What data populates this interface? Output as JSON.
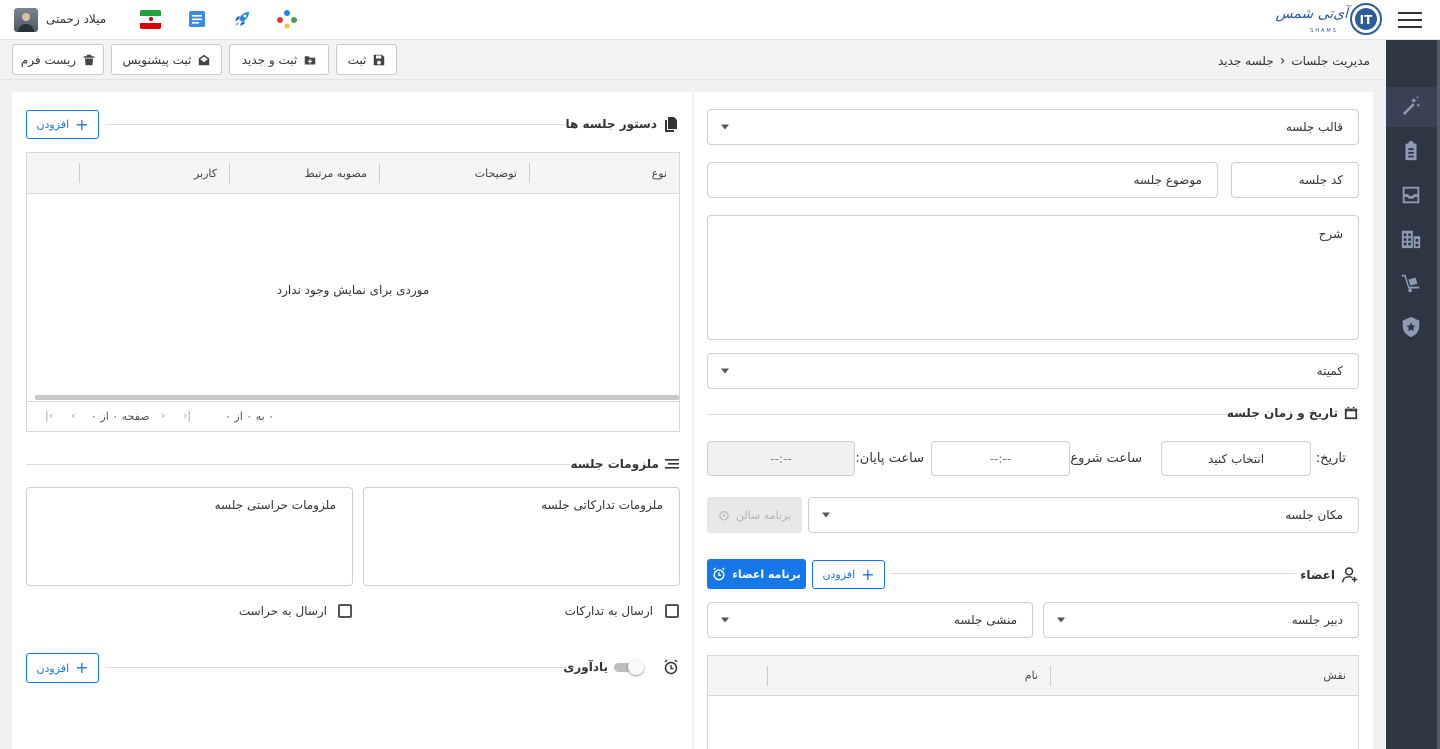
{
  "header": {
    "user_name": "میلاد زحمتی",
    "logo_text": "آی‌تی‌ شمس",
    "logo_sub": "SHAMS"
  },
  "breadcrumb": {
    "root": "مدیریت جلسات",
    "current": "جلسه جدید"
  },
  "toolbar": {
    "save": "ثبت",
    "save_new": "ثبت و جدید",
    "save_draft": "ثبت پیشنویس",
    "reset": "ریست فرم"
  },
  "form": {
    "template": "قالب جلسه",
    "code": "کد جلسه",
    "subject": "موضوع جلسه",
    "description": "شرح",
    "committee": "کمیته",
    "datetime_title": "تاریخ و زمان جلسه",
    "date_label": "تاریخ:",
    "date_value": "انتخاب کنید",
    "start_label": "ساعت شروع:",
    "start_value": "--:--",
    "end_label": "ساعت پایان:",
    "end_value": "--:--",
    "location": "مکان جلسه",
    "hall_schedule": "برنامه سالن",
    "members_title": "اعضاء",
    "members_add": "افزودن",
    "members_schedule": "برنامه اعضاء",
    "secretary": "دبیر جلسه",
    "clerk": "منشی جلسه",
    "members_grid": {
      "columns": [
        "نقش",
        "نام"
      ]
    }
  },
  "agenda": {
    "title": "دستور جلسه ها",
    "add": "افزودن",
    "columns": [
      "نوع",
      "توضیحات",
      "مصوبه مرتبط",
      "کاربر"
    ],
    "empty": "موردی برای نمایش وجود ندارد",
    "pager_range": "۰ به ۰ از ۰",
    "pager_page": "صفحه ۰ از ۰"
  },
  "requirements": {
    "title": "ملزومات جلسه",
    "logistics": "ملزومات تدارکاتی جلسه",
    "security": "ملزومات حراستی جلسه",
    "send_logistics": "ارسال به تدارکات",
    "send_security": "ارسال به حراست"
  },
  "reminder": {
    "title": "یادآوری",
    "add": "افزودن"
  },
  "colors": {
    "primary": "#1677e8",
    "sidebar": "#2f3542",
    "sidebar_icon": "#8f9bb3"
  }
}
